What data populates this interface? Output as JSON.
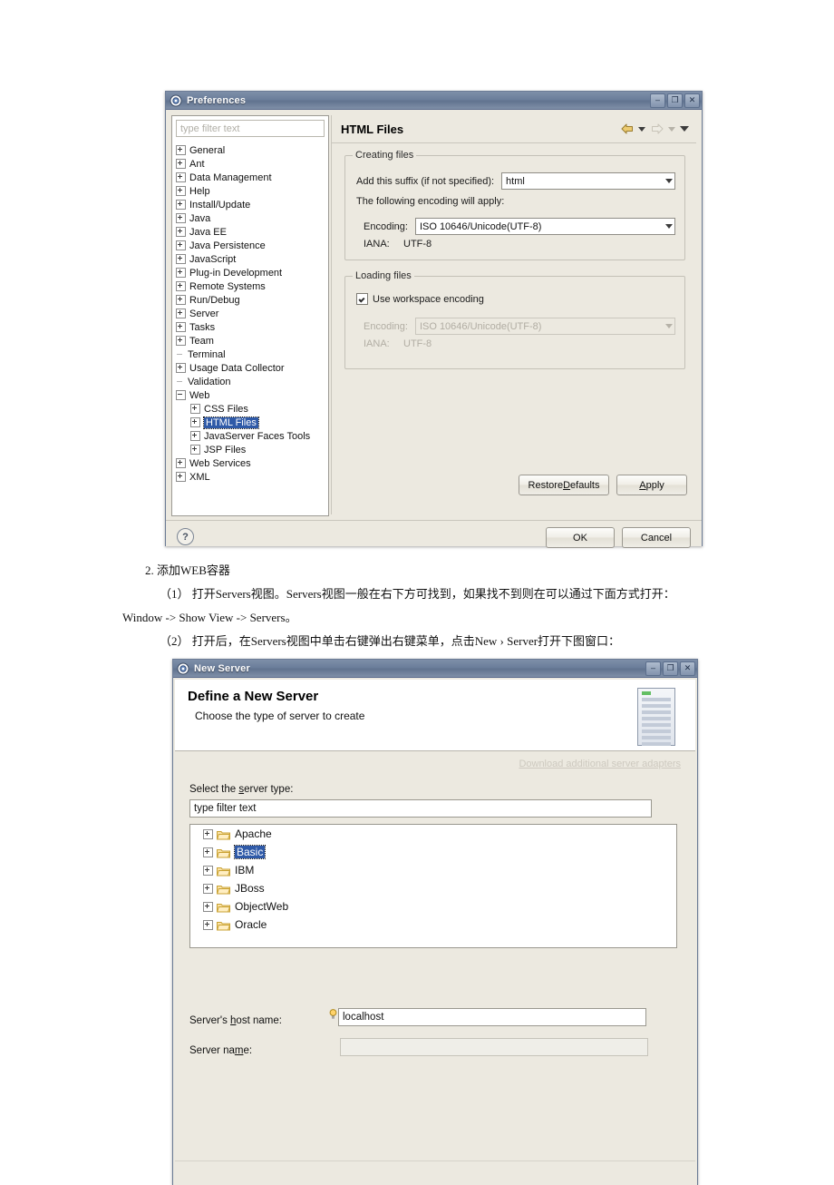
{
  "preferences": {
    "window_title": "Preferences",
    "window_icon": "eclipse-preferences-icon",
    "titlebar_buttons": [
      {
        "name": "minimize-button",
        "glyph": "–"
      },
      {
        "name": "maximize-button",
        "glyph": "❐"
      },
      {
        "name": "close-button",
        "glyph": "✕"
      }
    ],
    "filter": {
      "placeholder": "type filter text",
      "value": ""
    },
    "tree": [
      {
        "label": "General",
        "expander": "plus",
        "indent": 0,
        "selected": false
      },
      {
        "label": "Ant",
        "expander": "plus",
        "indent": 0,
        "selected": false
      },
      {
        "label": "Data Management",
        "expander": "plus",
        "indent": 0,
        "selected": false
      },
      {
        "label": "Help",
        "expander": "plus",
        "indent": 0,
        "selected": false
      },
      {
        "label": "Install/Update",
        "expander": "plus",
        "indent": 0,
        "selected": false
      },
      {
        "label": "Java",
        "expander": "plus",
        "indent": 0,
        "selected": false
      },
      {
        "label": "Java EE",
        "expander": "plus",
        "indent": 0,
        "selected": false
      },
      {
        "label": "Java Persistence",
        "expander": "plus",
        "indent": 0,
        "selected": false
      },
      {
        "label": "JavaScript",
        "expander": "plus",
        "indent": 0,
        "selected": false
      },
      {
        "label": "Plug-in Development",
        "expander": "plus",
        "indent": 0,
        "selected": false
      },
      {
        "label": "Remote Systems",
        "expander": "plus",
        "indent": 0,
        "selected": false
      },
      {
        "label": "Run/Debug",
        "expander": "plus",
        "indent": 0,
        "selected": false
      },
      {
        "label": "Server",
        "expander": "plus",
        "indent": 0,
        "selected": false
      },
      {
        "label": "Tasks",
        "expander": "plus",
        "indent": 0,
        "selected": false
      },
      {
        "label": "Team",
        "expander": "plus",
        "indent": 0,
        "selected": false
      },
      {
        "label": "Terminal",
        "expander": "none",
        "indent": 0,
        "selected": false
      },
      {
        "label": "Usage Data Collector",
        "expander": "plus",
        "indent": 0,
        "selected": false
      },
      {
        "label": "Validation",
        "expander": "none",
        "indent": 0,
        "selected": false
      },
      {
        "label": "Web",
        "expander": "minus",
        "indent": 0,
        "selected": false
      },
      {
        "label": "CSS Files",
        "expander": "plus",
        "indent": 1,
        "selected": false
      },
      {
        "label": "HTML Files",
        "expander": "plus",
        "indent": 1,
        "selected": true
      },
      {
        "label": "JavaServer Faces Tools",
        "expander": "plus",
        "indent": 1,
        "selected": false
      },
      {
        "label": "JSP Files",
        "expander": "plus",
        "indent": 1,
        "selected": false
      },
      {
        "label": "Web Services",
        "expander": "plus",
        "indent": 0,
        "selected": false
      },
      {
        "label": "XML",
        "expander": "plus",
        "indent": 0,
        "selected": false
      }
    ],
    "page": {
      "title": "HTML Files",
      "nav": {
        "back": "back-arrow",
        "back_menu": "back-dropdown",
        "forward": "forward-arrow",
        "forward_menu": "forward-dropdown",
        "menu": "view-menu"
      },
      "creating_files": {
        "legend": "Creating files",
        "suffix_label": "Add this suffix (if not specified):",
        "suffix_value": "html",
        "encoding_note": "The following encoding will apply:",
        "encoding_label": "Encoding:",
        "encoding_value": "ISO 10646/Unicode(UTF-8)",
        "iana_label": "IANA:",
        "iana_value": "UTF-8"
      },
      "loading_files": {
        "legend": "Loading files",
        "use_workspace_label": "Use workspace encoding",
        "use_workspace_checked": true,
        "encoding_label": "Encoding:",
        "encoding_value": "ISO 10646/Unicode(UTF-8)",
        "iana_label": "IANA:",
        "iana_value": "UTF-8"
      }
    },
    "buttons": {
      "restore_defaults_pre": "Restore ",
      "restore_defaults_key": "D",
      "restore_defaults_post": "efaults",
      "apply_pre": "",
      "apply_key": "A",
      "apply_post": "pply",
      "ok": "OK",
      "cancel": "Cancel",
      "help": "?"
    }
  },
  "prose": {
    "heading": "2. 添加WEB容器",
    "line1": "（1） 打开Servers视图。Servers视图一般在右下方可找到，如果找不到则在可以通过下面方式打开：",
    "line2": "Window -> Show View -> Servers。",
    "line3": "（2） 打开后，在Servers视图中单击右键弹出右键菜单，点击New › Server打开下图窗口："
  },
  "new_server": {
    "window_title": "New Server",
    "window_icon": "eclipse-wizard-icon",
    "titlebar_buttons": [
      {
        "name": "minimize-button",
        "glyph": "–"
      },
      {
        "name": "maximize-button",
        "glyph": "❐"
      },
      {
        "name": "close-button",
        "glyph": "✕"
      }
    ],
    "header_title": "Define a New Server",
    "header_subtitle": "Choose the type of server to create",
    "download_link": "Download additional server adapters",
    "select_label_pre": "Select the ",
    "select_label_key": "s",
    "select_label_post": "erver type:",
    "filter": {
      "value": "type filter text",
      "placeholder": "type filter text"
    },
    "tree": [
      {
        "label": "Apache",
        "selected": false
      },
      {
        "label": "Basic",
        "selected": true
      },
      {
        "label": "IBM",
        "selected": false
      },
      {
        "label": "JBoss",
        "selected": false
      },
      {
        "label": "ObjectWeb",
        "selected": false
      },
      {
        "label": "Oracle",
        "selected": false
      }
    ],
    "host_label_pre": "Server's ",
    "host_label_key": "h",
    "host_label_post": "ost name:",
    "host_value": "localhost",
    "name_label_pre": "Server na",
    "name_label_key": "m",
    "name_label_post": "e:",
    "name_value": "",
    "name_placeholder": ""
  },
  "colors": {
    "dialog_bg": "#ece9e0",
    "title_bar": "#6b7e9b",
    "selection": "#2f5aa8",
    "folder": "#f5c96a",
    "back_arrow": "#e8c86a",
    "disabled_text": "#b1ada3"
  }
}
